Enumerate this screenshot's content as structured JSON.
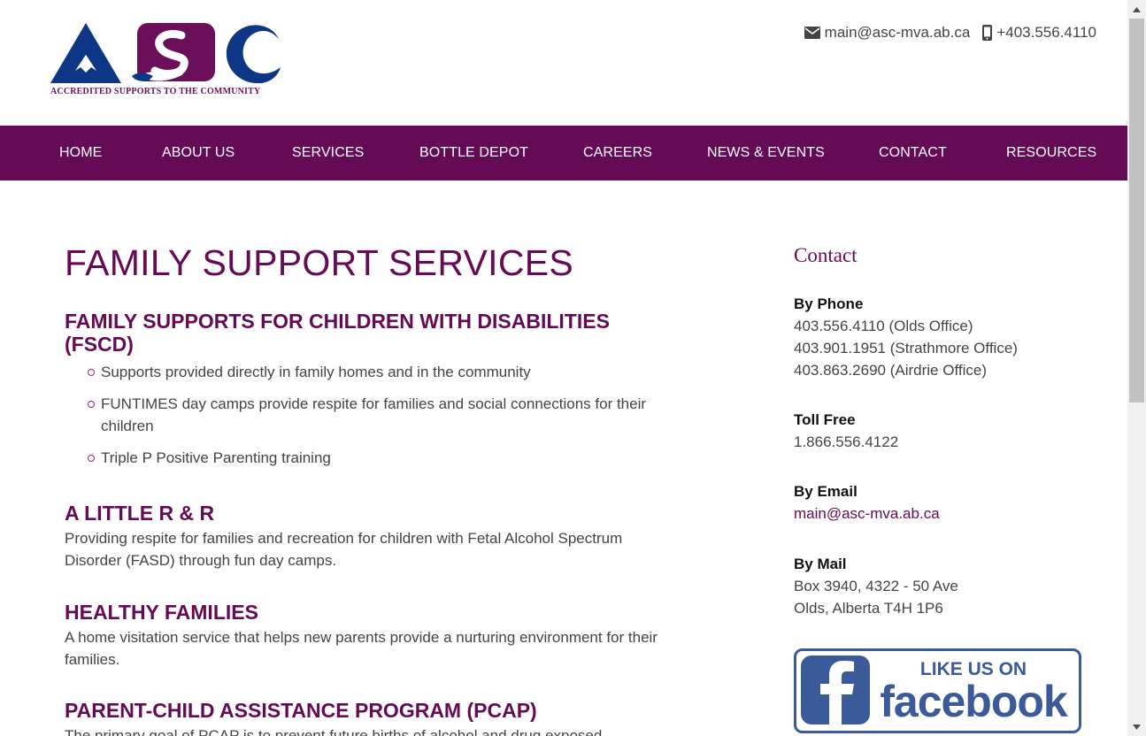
{
  "header": {
    "logo_text": "ASC",
    "logo_caption": "ACCREDITED SUPPORTS TO THE COMMUNITY",
    "email": "main@asc-mva.ab.ca",
    "phone": "+403.556.4110",
    "icons": [
      "envelope-icon",
      "mobile-phone-icon"
    ]
  },
  "nav": {
    "items": [
      {
        "label": "HOME"
      },
      {
        "label": "ABOUT US"
      },
      {
        "label": "SERVICES"
      },
      {
        "label": "BOTTLE DEPOT"
      },
      {
        "label": "CAREERS"
      },
      {
        "label": "NEWS & EVENTS"
      },
      {
        "label": "CONTACT"
      },
      {
        "label": "RESOURCES"
      }
    ]
  },
  "main": {
    "title": "FAMILY SUPPORT SERVICES",
    "sections": [
      {
        "title": "FAMILY SUPPORTS FOR CHILDREN WITH DISABILITIES (FSCD)",
        "bullets": [
          "Supports provided directly in family homes and in the community",
          "FUNTIMES day camps provide respite for families and social connections for their children",
          "Triple P Positive Parenting training"
        ]
      },
      {
        "title": "A LITTLE R & R",
        "text": "Providing respite for families and recreation for children with Fetal Alcohol Spectrum Disorder (FASD) through fun day camps."
      },
      {
        "title": "HEALTHY FAMILIES",
        "text": "A home visitation service that helps new parents provide a nurturing environment for their families."
      },
      {
        "title": "PARENT-CHILD ASSISTANCE PROGRAM (PCAP)",
        "text": "The primary goal of PCAP is to prevent future births of alcohol and drug exposed"
      }
    ]
  },
  "sidebar": {
    "title": "Contact",
    "phone_heading": "By Phone",
    "phones": [
      "403.556.4110 (Olds Office)",
      "403.901.1951 (Strathmore Office)",
      "403.863.2690 (Airdrie Office)"
    ],
    "tollfree_heading": "Toll Free",
    "tollfree": "1.866.556.4122",
    "email_heading": "By Email",
    "email": "main@asc-mva.ab.ca",
    "mail_heading": "By Mail",
    "mail_lines": [
      "Box 3940, 4322 - 50 Ave",
      "Olds, Alberta T4H 1P6"
    ],
    "facebook": {
      "line1": "LIKE US ON",
      "line2": "facebook"
    }
  },
  "colors": {
    "brand_purple": "#650a54",
    "logo_navy": "#0d3685",
    "logo_purple": "#6b0f5a",
    "facebook_blue": "#3b5a9a"
  }
}
